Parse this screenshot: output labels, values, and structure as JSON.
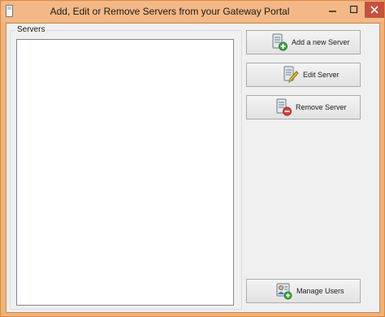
{
  "window": {
    "title": "Add, Edit or Remove Servers from your Gateway Portal",
    "controls": {
      "minimize": "–",
      "maximize": "□",
      "close": "✕"
    },
    "colors": {
      "frame": "#f0b27a",
      "close_button": "#c7503f"
    }
  },
  "servers_group": {
    "label": "Servers",
    "items": []
  },
  "buttons": {
    "add_server": {
      "label": "Add a new Server",
      "icon": "server-add-icon"
    },
    "edit_server": {
      "label": "Edit Server",
      "icon": "server-edit-icon"
    },
    "remove_server": {
      "label": "Remove Server",
      "icon": "server-remove-icon"
    },
    "manage_users": {
      "label": "Manage Users",
      "icon": "users-add-icon"
    }
  }
}
